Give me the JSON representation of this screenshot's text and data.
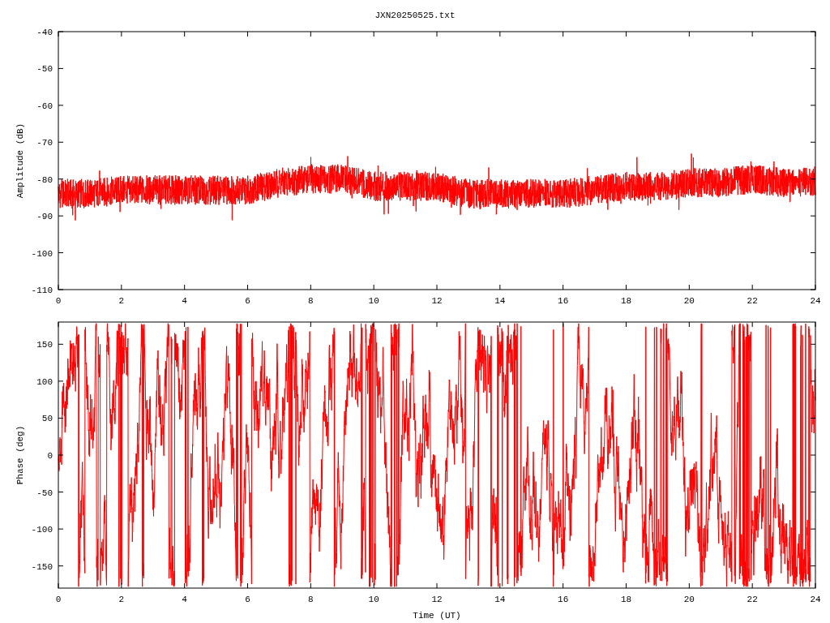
{
  "title": "JXN20250525.txt",
  "amplitude_plot": {
    "y_axis_label": "Amplitude (dB)",
    "y_tick_labels": [
      "-40",
      "-50",
      "-60",
      "-70",
      "-80",
      "-90",
      "-100",
      "-110"
    ],
    "x_tick_labels": [
      "0",
      "2",
      "4",
      "6",
      "8",
      "10",
      "12",
      "14",
      "16",
      "18",
      "20",
      "22",
      "24"
    ]
  },
  "phase_plot": {
    "y_axis_label": "Phase (deg)",
    "x_axis_label": "Time (UT)",
    "y_tick_labels": [
      "150",
      "100",
      "50",
      "0",
      "-50",
      "-100",
      "-150"
    ],
    "x_tick_labels": [
      "0",
      "2",
      "4",
      "6",
      "8",
      "10",
      "12",
      "14",
      "16",
      "18",
      "20",
      "22",
      "24"
    ]
  }
}
